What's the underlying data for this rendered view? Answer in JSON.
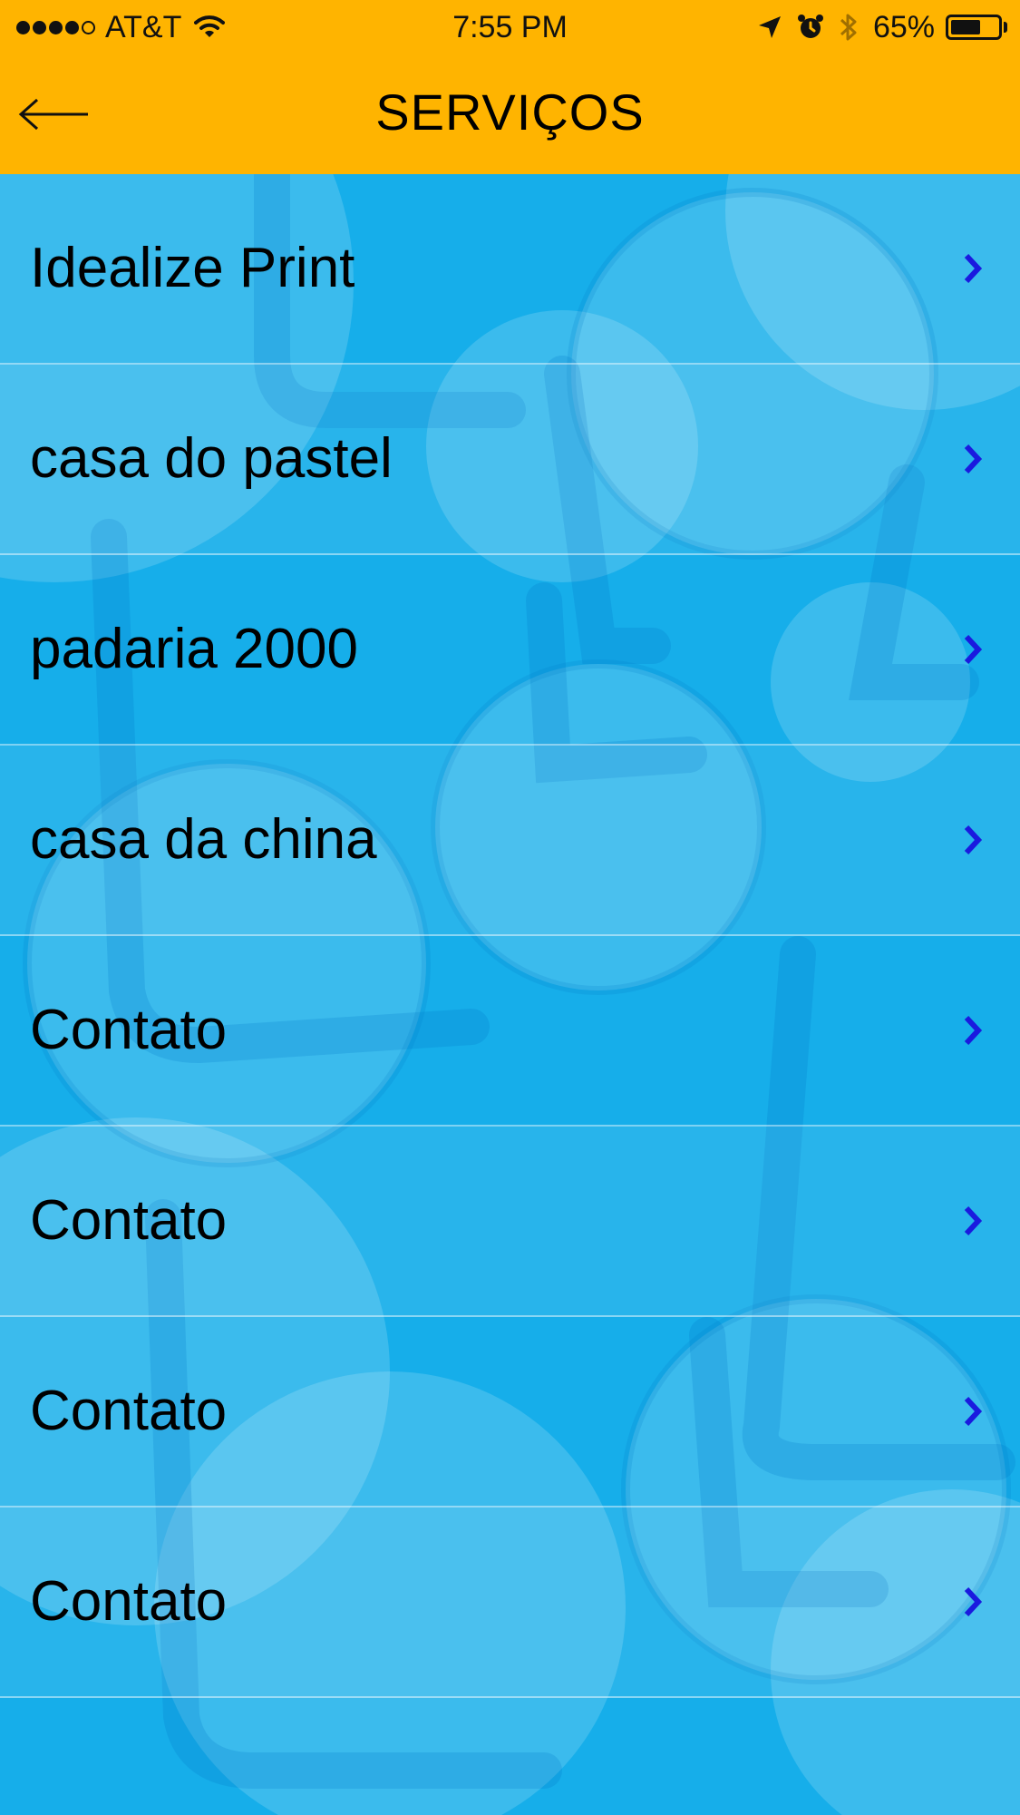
{
  "status_bar": {
    "carrier": "AT&T",
    "signal_bars_filled": 4,
    "signal_bars_total": 5,
    "time": "7:55 PM",
    "battery_percent": "65%",
    "battery_level": 0.65
  },
  "nav": {
    "title": "SERVIÇOS",
    "back_icon": "arrow-left-icon"
  },
  "list": {
    "items": [
      {
        "label": "Idealize Print"
      },
      {
        "label": "casa do pastel"
      },
      {
        "label": "padaria 2000"
      },
      {
        "label": "casa da china"
      },
      {
        "label": "Contato"
      },
      {
        "label": "Contato"
      },
      {
        "label": "Contato"
      },
      {
        "label": "Contato"
      }
    ],
    "chevron_icon": "chevron-right-icon"
  },
  "colors": {
    "header": "#ffb400",
    "background": "#16aeea",
    "chevron": "#1a1adf",
    "text": "#000000"
  }
}
